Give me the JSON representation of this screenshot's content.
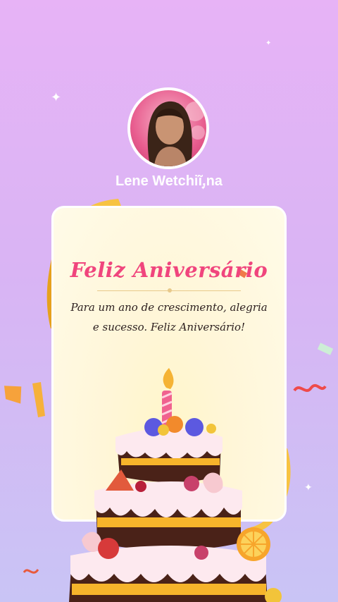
{
  "profile": {
    "name": "Lene Wetchiĩ,na"
  },
  "card": {
    "title": "Feliz Aniversário",
    "message": "Para um ano de crescimento, alegria e sucesso. Feliz Aniversário!"
  },
  "colors": {
    "title": "#f0457d",
    "background_top": "#e7b3f6",
    "background_bottom": "#c9c4f5",
    "card": "#fff6d8"
  },
  "icons": [
    "sparkle-icon",
    "ribbon-icon",
    "birthday-cake-icon",
    "candle-icon"
  ]
}
